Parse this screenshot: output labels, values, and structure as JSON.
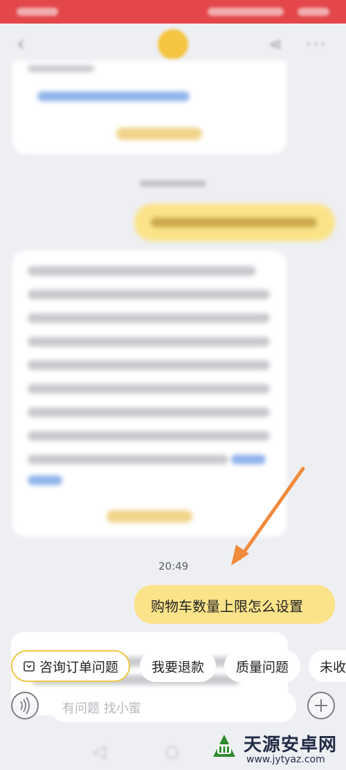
{
  "chat": {
    "timestamp": "20:49",
    "user_message": "购物车数量上限怎么设置"
  },
  "quick_replies": [
    {
      "label": "咨询订单问题",
      "icon": "order-icon"
    },
    {
      "label": "我要退款"
    },
    {
      "label": "质量问题"
    },
    {
      "label": "未收"
    }
  ],
  "input": {
    "placeholder": "有问题 找小蜜"
  },
  "watermark": {
    "title": "天源安卓网",
    "url": "www.jytyaz.com"
  },
  "colors": {
    "status_bar": "#e3474a",
    "bubble": "#fbe38a",
    "arrow": "#f08a3c",
    "chip_border": "#f0c64a"
  }
}
